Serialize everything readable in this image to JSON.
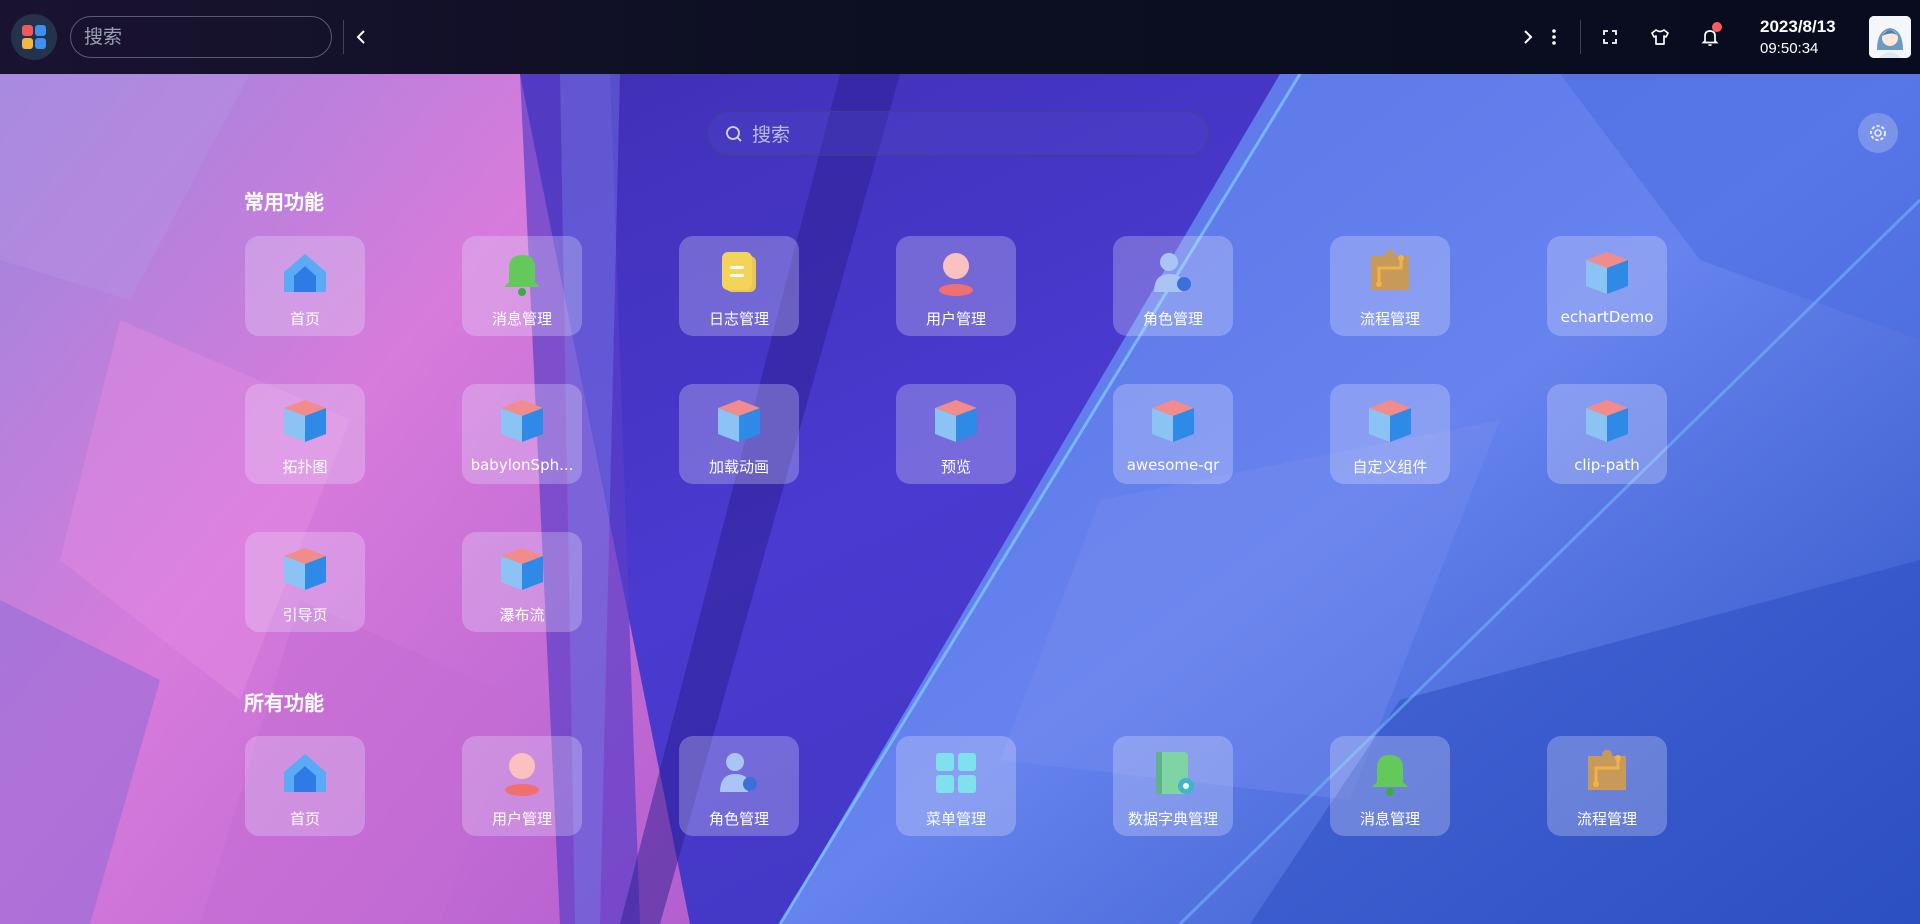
{
  "topbar": {
    "search_placeholder": "搜索",
    "date": "2023/8/13",
    "time": "09:50:34",
    "icons": [
      "app-logo-icon",
      "chevron-left-icon",
      "chevron-right-icon",
      "more-vertical-icon",
      "fullscreen-icon",
      "tshirt-icon",
      "bell-icon",
      "avatar"
    ],
    "notification_dot_color": "#ff5b5b"
  },
  "main": {
    "search_placeholder": "搜索",
    "settings_icon": "gear-icon"
  },
  "sections": {
    "common": {
      "title": "常用功能",
      "items": [
        {
          "label": "首页",
          "icon": "home-icon"
        },
        {
          "label": "消息管理",
          "icon": "bell-icon"
        },
        {
          "label": "日志管理",
          "icon": "log-icon"
        },
        {
          "label": "用户管理",
          "icon": "user-icon"
        },
        {
          "label": "角色管理",
          "icon": "role-icon"
        },
        {
          "label": "流程管理",
          "icon": "flow-icon"
        },
        {
          "label": "echartDemo",
          "icon": "cube-icon"
        },
        {
          "label": "拓扑图",
          "icon": "cube-icon"
        },
        {
          "label": "babylonSph...",
          "icon": "cube-icon"
        },
        {
          "label": "加载动画",
          "icon": "cube-icon"
        },
        {
          "label": "预览",
          "icon": "cube-icon"
        },
        {
          "label": "awesome-qr",
          "icon": "cube-icon"
        },
        {
          "label": "自定义组件",
          "icon": "cube-icon"
        },
        {
          "label": "clip-path",
          "icon": "cube-icon"
        },
        {
          "label": "引导页",
          "icon": "cube-icon"
        },
        {
          "label": "瀑布流",
          "icon": "cube-icon"
        }
      ]
    },
    "all": {
      "title": "所有功能",
      "items": [
        {
          "label": "首页",
          "icon": "home-icon"
        },
        {
          "label": "用户管理",
          "icon": "user-icon"
        },
        {
          "label": "角色管理",
          "icon": "role-icon"
        },
        {
          "label": "菜单管理",
          "icon": "menu-grid-icon"
        },
        {
          "label": "数据字典管理",
          "icon": "dictionary-icon"
        },
        {
          "label": "消息管理",
          "icon": "bell-icon"
        },
        {
          "label": "流程管理",
          "icon": "flow-icon"
        }
      ]
    }
  }
}
